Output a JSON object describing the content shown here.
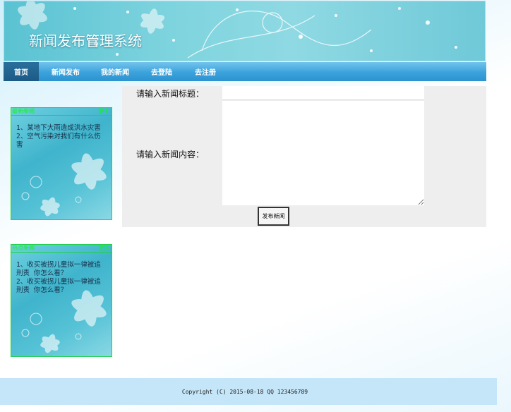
{
  "header": {
    "site_title": "新闻发布管理系统"
  },
  "nav": {
    "items": [
      {
        "label": "首页"
      },
      {
        "label": "新闻发布"
      },
      {
        "label": "我的新闻"
      },
      {
        "label": "去登陆"
      },
      {
        "label": "去注册"
      }
    ],
    "active_index": 0
  },
  "sidebar": {
    "boxes": [
      {
        "title": "最新新闻",
        "more": "更多",
        "items": [
          "1、某地下大雨造成洪水灾害",
          "2、空气污染对我们有什么伤害"
        ]
      },
      {
        "title": "热点新闻",
        "more": "更多",
        "items": [
          "1、收买被拐儿童拟一律被追刑责 你怎么看？",
          "2、收买被拐儿童拟一律被追刑责 你怎么看？"
        ]
      }
    ]
  },
  "form": {
    "title_label": "请输入新闻标题：",
    "title_value": "",
    "content_label": "请输入新闻内容：",
    "content_value": "",
    "submit_label": "发布新闻"
  },
  "footer": {
    "copyright": "Copyright (C) 2015-08-18   QQ 123456789"
  },
  "colors": {
    "nav_blue": "#3ba2dc",
    "box_border": "#21d14a",
    "footer_bg": "#c4e6f8"
  }
}
